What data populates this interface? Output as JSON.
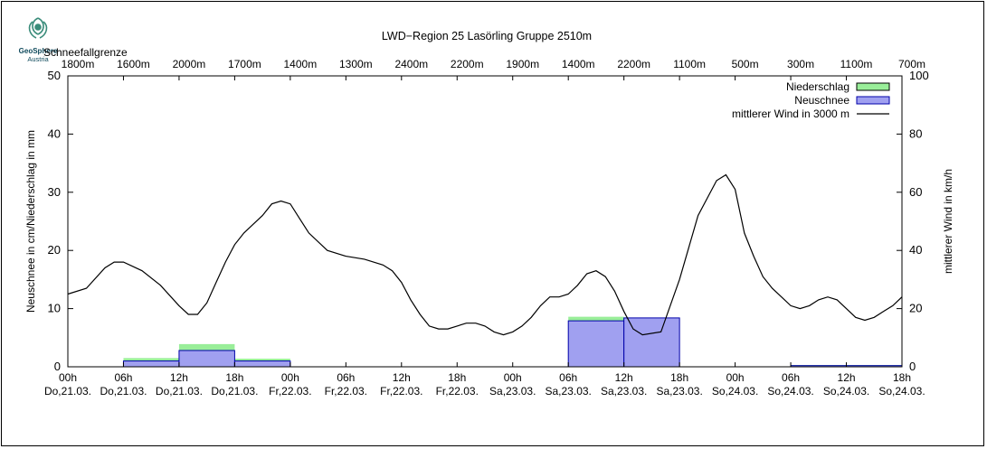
{
  "logo": {
    "name": "GeoSphere",
    "sub": "Austria",
    "accent": "#3a8c7a"
  },
  "chart_data": {
    "type": "bar",
    "title": "LWD−Region 25 Lasörling Gruppe 2510m",
    "top_axis_title": "Schneefallgrenze",
    "snowline": [
      "1800m",
      "1600m",
      "2000m",
      "1700m",
      "1400m",
      "1300m",
      "2400m",
      "2200m",
      "1900m",
      "1400m",
      "2200m",
      "1100m",
      "500m",
      "300m",
      "1100m",
      "700m"
    ],
    "x_ticks": [
      {
        "time": "00h",
        "day": "Do,21.03."
      },
      {
        "time": "06h",
        "day": "Do,21.03."
      },
      {
        "time": "12h",
        "day": "Do,21.03."
      },
      {
        "time": "18h",
        "day": "Do,21.03."
      },
      {
        "time": "00h",
        "day": "Fr,22.03."
      },
      {
        "time": "06h",
        "day": "Fr,22.03."
      },
      {
        "time": "12h",
        "day": "Fr,22.03."
      },
      {
        "time": "18h",
        "day": "Fr,22.03."
      },
      {
        "time": "00h",
        "day": "Sa,23.03."
      },
      {
        "time": "06h",
        "day": "Sa,23.03."
      },
      {
        "time": "12h",
        "day": "Sa,23.03."
      },
      {
        "time": "18h",
        "day": "Sa,23.03."
      },
      {
        "time": "00h",
        "day": "So,24.03."
      },
      {
        "time": "06h",
        "day": "So,24.03."
      },
      {
        "time": "12h",
        "day": "So,24.03."
      },
      {
        "time": "18h",
        "day": "So,24.03."
      }
    ],
    "xlim": [
      0,
      90
    ],
    "ylabel": "Neuschnee in cm/Niederschlag in mm",
    "ylim": [
      0,
      50
    ],
    "y_ticks": [
      0,
      10,
      20,
      30,
      40,
      50
    ],
    "y2label": "mittlerer Wind in km/h",
    "y2lim": [
      0,
      100
    ],
    "y2_ticks": [
      0,
      20,
      40,
      60,
      80,
      100
    ],
    "legend_position": "top-right",
    "grid": false,
    "series": [
      {
        "name": "Niederschlag",
        "kind": "bar",
        "color": "#99ee99",
        "bars": [
          {
            "x0": 6,
            "x1": 12,
            "value": 1.5
          },
          {
            "x0": 12,
            "x1": 18,
            "value": 3.9
          },
          {
            "x0": 18,
            "x1": 24,
            "value": 1.4
          },
          {
            "x0": 54,
            "x1": 60,
            "value": 8.6
          },
          {
            "x0": 60,
            "x1": 66,
            "value": 8.4
          },
          {
            "x0": 78,
            "x1": 90,
            "value": 0.3
          }
        ]
      },
      {
        "name": "Neuschnee",
        "kind": "bar",
        "color": "#a0a0f0",
        "edge": "#0000aa",
        "bars": [
          {
            "x0": 6,
            "x1": 12,
            "value": 1.0
          },
          {
            "x0": 12,
            "x1": 18,
            "value": 2.8
          },
          {
            "x0": 18,
            "x1": 24,
            "value": 1.0
          },
          {
            "x0": 54,
            "x1": 60,
            "value": 7.9
          },
          {
            "x0": 60,
            "x1": 66,
            "value": 8.4
          },
          {
            "x0": 78,
            "x1": 90,
            "value": 0.2
          }
        ]
      },
      {
        "name": "mittlerer Wind in 3000 m",
        "kind": "line",
        "color": "#000000",
        "axis": "y2",
        "x": [
          0,
          2,
          4,
          5,
          6,
          8,
          10,
          12,
          13,
          14,
          15,
          16,
          17,
          18,
          19,
          20,
          21,
          22,
          23,
          24,
          25,
          26,
          28,
          30,
          32,
          34,
          35,
          36,
          37,
          38,
          39,
          40,
          41,
          42,
          43,
          44,
          45,
          46,
          47,
          48,
          49,
          50,
          51,
          52,
          53,
          54,
          55,
          56,
          57,
          58,
          59,
          60,
          61,
          62,
          64,
          66,
          68,
          70,
          71,
          72,
          73,
          74,
          75,
          76,
          77,
          78,
          79,
          80,
          81,
          82,
          83,
          84,
          85,
          86,
          87,
          88,
          89,
          90
        ],
        "y": [
          25,
          27,
          34,
          36,
          36,
          33,
          28,
          21,
          18,
          18,
          22,
          29,
          36,
          42,
          46,
          49,
          52,
          56,
          57,
          56,
          51,
          46,
          40,
          38,
          37,
          35,
          33,
          29,
          23,
          18,
          14,
          13,
          13,
          14,
          15,
          15,
          14,
          12,
          11,
          12,
          14,
          17,
          21,
          24,
          24,
          25,
          28,
          32,
          33,
          31,
          26,
          19,
          13,
          11,
          12,
          30,
          52,
          64,
          66,
          61,
          46,
          38,
          31,
          27,
          24,
          21,
          20,
          21,
          23,
          24,
          23,
          20,
          17,
          16,
          17,
          19,
          21,
          24
        ]
      }
    ]
  }
}
